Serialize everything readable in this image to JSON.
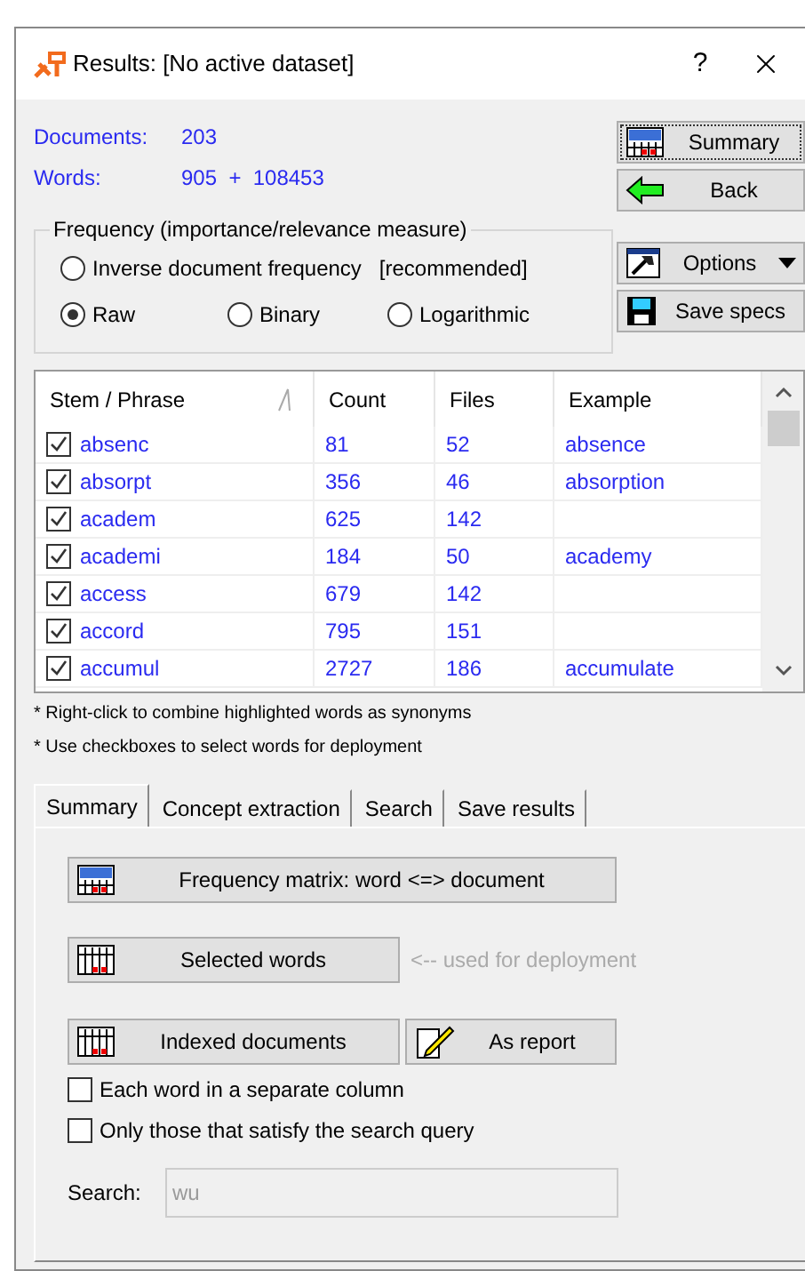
{
  "window": {
    "title": "Results: [No active dataset]",
    "help": "?"
  },
  "stats": [
    {
      "label": "Documents:",
      "value": "203"
    },
    {
      "label": "Words:",
      "value": "905  +  108453"
    }
  ],
  "frequency": {
    "title": "Frequency (importance/relevance measure)",
    "options": [
      {
        "label": "Inverse document frequency",
        "note": "[recommended]",
        "selected": false
      },
      {
        "label": "Raw",
        "selected": true
      },
      {
        "label": "Binary",
        "selected": false
      },
      {
        "label": "Logarithmic",
        "selected": false
      }
    ]
  },
  "side_buttons": [
    {
      "label": "Summary",
      "kind": "summary",
      "focused": true
    },
    {
      "label": "Back",
      "kind": "back",
      "focused": false
    },
    {
      "label": "Options",
      "kind": "options",
      "focused": false
    },
    {
      "label": "Save specs",
      "kind": "save",
      "focused": false
    }
  ],
  "table": {
    "columns": [
      "Stem / Phrase",
      "Count",
      "Files",
      "Example"
    ],
    "rows": [
      {
        "checked": true,
        "cells": [
          "absenc",
          "81",
          "52",
          "absence"
        ]
      },
      {
        "checked": true,
        "cells": [
          "absorpt",
          "356",
          "46",
          "absorption"
        ]
      },
      {
        "checked": true,
        "cells": [
          "academ",
          "625",
          "142",
          ""
        ]
      },
      {
        "checked": true,
        "cells": [
          "academi",
          "184",
          "50",
          "academy"
        ]
      },
      {
        "checked": true,
        "cells": [
          "access",
          "679",
          "142",
          ""
        ]
      },
      {
        "checked": true,
        "cells": [
          "accord",
          "795",
          "151",
          ""
        ]
      },
      {
        "checked": true,
        "cells": [
          "accumul",
          "2727",
          "186",
          "accumulate"
        ]
      }
    ]
  },
  "notes": [
    "* Right-click to combine highlighted words as synonyms",
    "* Use checkboxes to select words for deployment"
  ],
  "tabs": [
    {
      "label": "Summary",
      "selected": true
    },
    {
      "label": "Concept extraction",
      "selected": false
    },
    {
      "label": "Search",
      "selected": false
    },
    {
      "label": "Save results",
      "selected": false
    }
  ],
  "summary": {
    "matrix_button": "Frequency matrix:  word  <=> document",
    "selected_button": "Selected words",
    "selected_hint": "<-- used for deployment",
    "indexed_button": "Indexed documents",
    "report_button": "As report",
    "checkboxes": [
      {
        "label": "Each word in a separate column",
        "checked": false
      },
      {
        "label": "Only those that satisfy the search query",
        "checked": false
      }
    ],
    "search": {
      "label": "Search:",
      "value": "wu",
      "disabled": true
    }
  }
}
